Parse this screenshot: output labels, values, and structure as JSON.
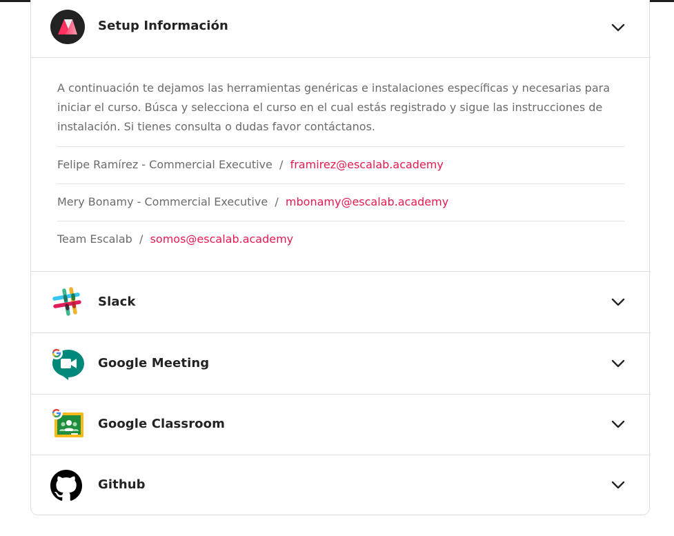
{
  "accordion": {
    "setup": {
      "title": "Setup Información",
      "logo_icon": "escalab-logo-icon",
      "state": "expanded",
      "description": "A continuación te dejamos las herramientas genéricas e instalaciones específicas y necesarias para iniciar el curso. Búsca y selecciona el curso en el cual estás registrado y sigue las instrucciones de instalación. Si tienes consulta o dudas favor contáctanos.",
      "contacts": [
        {
          "name": "Felipe Ramírez - Commercial Executive",
          "separator": "/",
          "email": "framirez@escalab.academy"
        },
        {
          "name": "Mery Bonamy - Commercial Executive",
          "separator": "/",
          "email": "mbonamy@escalab.academy"
        },
        {
          "name": "Team Escalab",
          "separator": "/",
          "email": "somos@escalab.academy"
        }
      ]
    },
    "items": [
      {
        "title": "Slack",
        "icon": "slack-icon",
        "state": "collapsed"
      },
      {
        "title": "Google Meeting",
        "icon": "google-meet-icon",
        "state": "collapsed"
      },
      {
        "title": "Google Classroom",
        "icon": "google-classroom-icon",
        "state": "collapsed"
      },
      {
        "title": "Github",
        "icon": "github-icon",
        "state": "collapsed"
      }
    ]
  },
  "colors": {
    "link": "#e8194f",
    "body_text": "#6b6b6b",
    "title_text": "#232323",
    "border": "#dedede"
  }
}
